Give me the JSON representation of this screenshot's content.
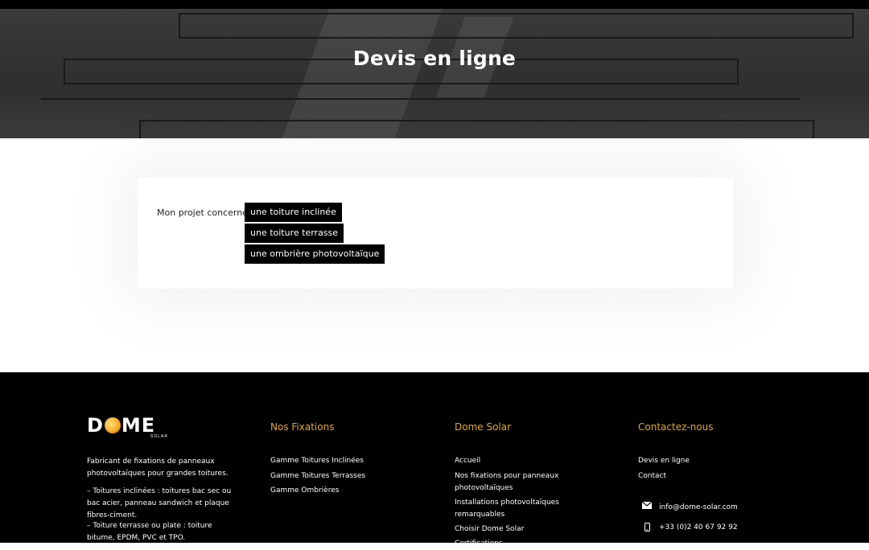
{
  "hero": {
    "title": "Devis en ligne"
  },
  "form": {
    "question": "Mon projet concerne",
    "options": [
      "une toiture inclinée",
      "une toiture terrasse",
      "une ombrière photovoltaïque"
    ]
  },
  "footer": {
    "logo": {
      "before": "D",
      "after": "ME",
      "sub": "SOLAR"
    },
    "about": {
      "intro": "Fabricant de fixations de panneaux photovoltaïques pour grandes toitures.",
      "line1": "– Toitures inclinées : toitures bac sec ou bac acier, panneau sandwich et plaque fibres-ciment.",
      "line2": "– Toiture terrasse ou plate : toiture bitume, EPDM, PVC et TPO."
    },
    "fixations": {
      "heading": "Nos Fixations",
      "links": [
        "Gamme Toitures Inclinées",
        "Gamme Toitures Terrasses",
        "Gamme Ombrières"
      ]
    },
    "dome": {
      "heading": "Dome Solar",
      "links": [
        "Accueil",
        "Nos fixations pour panneaux photovoltaïques",
        "Installations photovoltaïques remarquables",
        "Choisir Dome Solar",
        "Certifications"
      ]
    },
    "contact": {
      "heading": "Contactez-nous",
      "links": [
        "Devis en ligne",
        "Contact"
      ],
      "email": "info@dome-solar.com",
      "phone": "+33 (0)2 40 67 92 92",
      "email_icon": "envelope-icon",
      "phone_icon": "mobile-phone-icon"
    }
  },
  "colors": {
    "accent": "#e3a72f",
    "button_bg": "#000000",
    "footer_bg": "#000000"
  }
}
